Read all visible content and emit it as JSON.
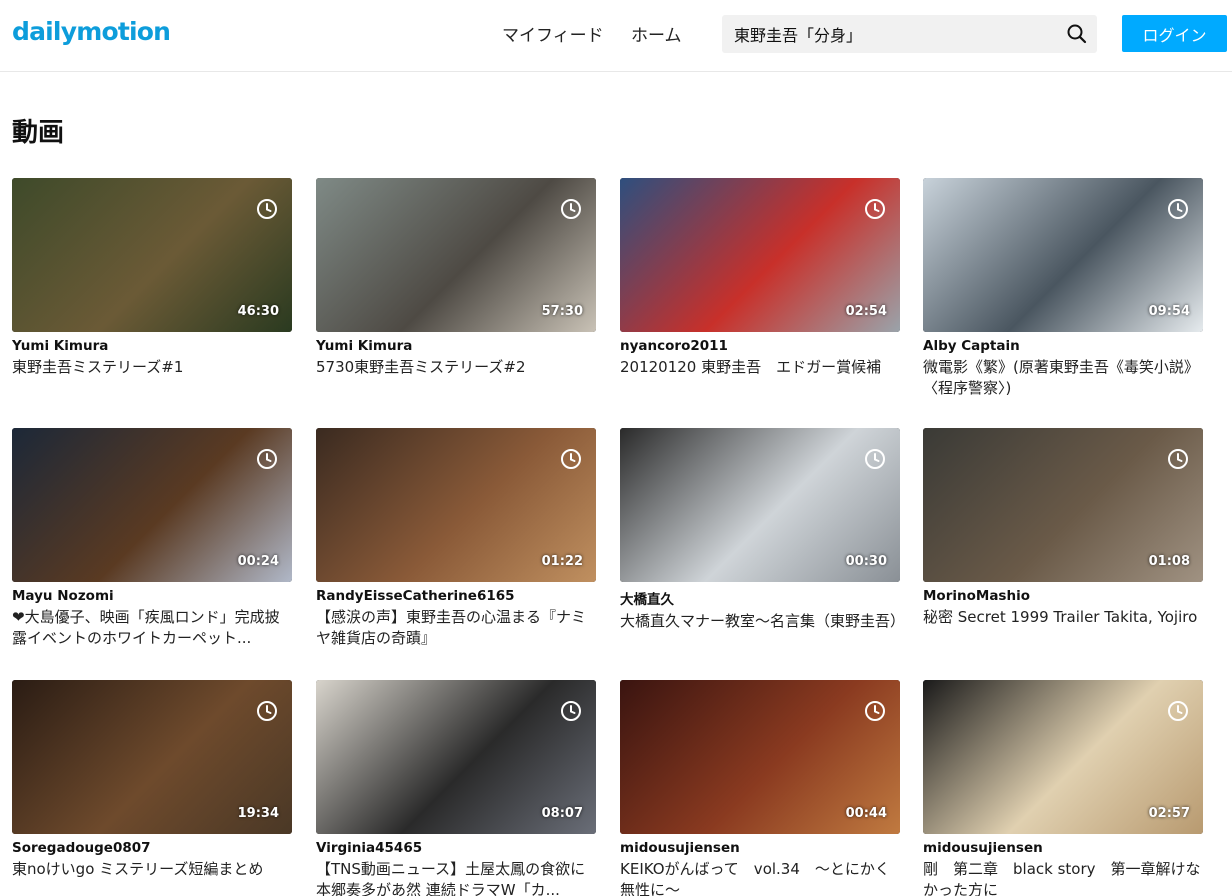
{
  "header": {
    "logo": "dailymotion",
    "nav": {
      "feed": "マイフィード",
      "home": "ホーム"
    },
    "search": {
      "value": "東野圭吾「分身」"
    },
    "login_label": "ログイン"
  },
  "section_title": "動画",
  "videos": [
    {
      "author": "Yumi Kimura",
      "title": "東野圭吾ミステリーズ#1",
      "duration": "46:30"
    },
    {
      "author": "Yumi Kimura",
      "title": "5730東野圭吾ミステリーズ#2",
      "duration": "57:30"
    },
    {
      "author": "nyancoro2011",
      "title": "20120120 東野圭吾　エドガー賞候補",
      "duration": "02:54"
    },
    {
      "author": "Alby Captain",
      "title": "微電影《繁》(原著東野圭吾《毒笑小説》〈程序警察〉)",
      "duration": "09:54"
    },
    {
      "author": "Mayu Nozomi",
      "title": "❤大島優子、映画「疾風ロンド」完成披露イベントのホワイトカーペット...",
      "duration": "00:24"
    },
    {
      "author": "RandyEisseCatherine6165",
      "title": "【感涙の声】東野圭吾の心温まる『ナミヤ雑貨店の奇蹟』",
      "duration": "01:22"
    },
    {
      "author": "大橋直久",
      "title": "大橋直久マナー教室～名言集（東野圭吾）",
      "duration": "00:30"
    },
    {
      "author": "MorinoMashio",
      "title": "秘密 Secret 1999 Trailer Takita, Yojiro",
      "duration": "01:08"
    },
    {
      "author": "Soregadouge0807",
      "title": "東noけいgo ミステリーズ短編まとめ",
      "duration": "19:34"
    },
    {
      "author": "Virginia45465",
      "title": "【TNS動画ニュース】土屋太鳳の食欲に本郷奏多があ然 連続ドラマW「カ...",
      "duration": "08:07"
    },
    {
      "author": "midousujiensen",
      "title": "KEIKOがんばって　vol.34　～とにかく無性に～",
      "duration": "00:44"
    },
    {
      "author": "midousujiensen",
      "title": "剛　第二章　black story　第一章解けなかった方に",
      "duration": "02:57"
    }
  ]
}
